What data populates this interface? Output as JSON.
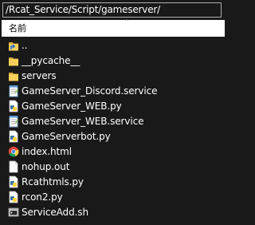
{
  "path": "/Rcat_Service/Script/gameserver/",
  "header": {
    "name_column": "名前"
  },
  "files": [
    {
      "name": "..",
      "icon": "up-folder-icon"
    },
    {
      "name": "__pycache__",
      "icon": "folder-icon"
    },
    {
      "name": "servers",
      "icon": "folder-icon"
    },
    {
      "name": "GameServer_Discord.service",
      "icon": "notepad-icon"
    },
    {
      "name": "GameServer_WEB.py",
      "icon": "python-file-icon"
    },
    {
      "name": "GameServer_WEB.service",
      "icon": "notepad-icon"
    },
    {
      "name": "GameServerbot.py",
      "icon": "python-file-icon"
    },
    {
      "name": "index.html",
      "icon": "chrome-icon"
    },
    {
      "name": "nohup.out",
      "icon": "blank-file-icon"
    },
    {
      "name": "Rcathtmls.py",
      "icon": "python-file-icon"
    },
    {
      "name": "rcon2.py",
      "icon": "python-file-icon"
    },
    {
      "name": "ServiceAdd.sh",
      "icon": "shell-script-icon"
    }
  ],
  "colors": {
    "background": "#191919",
    "text": "#ffffff",
    "folder": "#f2c84b",
    "header_bg": "#ffffff"
  }
}
